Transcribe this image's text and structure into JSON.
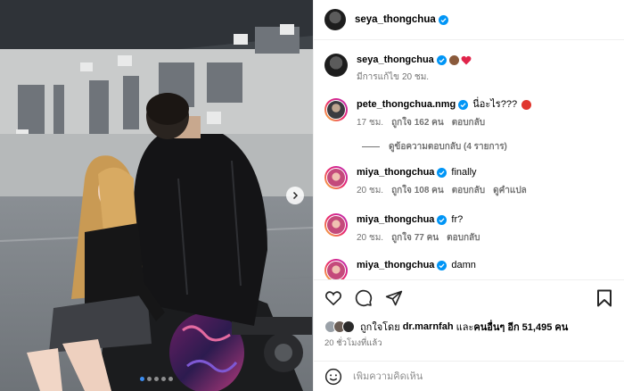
{
  "post": {
    "author": "seya_thongchua",
    "colors": {
      "verified": "#0095f6",
      "heart": "#ed4956",
      "link": "#0095f6"
    }
  },
  "caption": {
    "username": "seya_thongchua",
    "emoji_icons": [
      "monkey-face-icon",
      "red-heart-icon"
    ],
    "edited": "มีการแก้ไข",
    "time": "20 ชม."
  },
  "comments": [
    {
      "username": "pete_thongchua.nmg",
      "text": "นี่อะไร???",
      "emoji_icon": "angry-face-icon",
      "time": "17 ชม.",
      "likes": "ถูกใจ 162 คน",
      "reply": "ตอบกลับ",
      "translate": ""
    },
    {
      "username": "miya_thongchua",
      "text": "finally",
      "time": "20 ชม.",
      "likes": "ถูกใจ 108 คน",
      "reply": "ตอบกลับ",
      "translate": "ดูคำแปล"
    },
    {
      "username": "miya_thongchua",
      "text": "fr?",
      "time": "20 ชม.",
      "likes": "ถูกใจ 77 คน",
      "reply": "ตอบกลับ",
      "translate": ""
    },
    {
      "username": "miya_thongchua",
      "text": "damn",
      "time": "",
      "likes": "",
      "reply": "",
      "translate": ""
    }
  ],
  "view_replies": "ดูข้อความตอบกลับ (4 รายการ)",
  "likes_summary": {
    "prefix": "ถูกใจโดย",
    "user": "dr.marnfah",
    "middle": "และ",
    "others": "คนอื่นๆ อีก 51,495 คน"
  },
  "post_time": "20 ชั่วโมงที่แล้ว",
  "comment_input": {
    "placeholder": "เพิ่มความคิดเห็น"
  },
  "carousel": {
    "total": 5,
    "active_index": 0
  }
}
